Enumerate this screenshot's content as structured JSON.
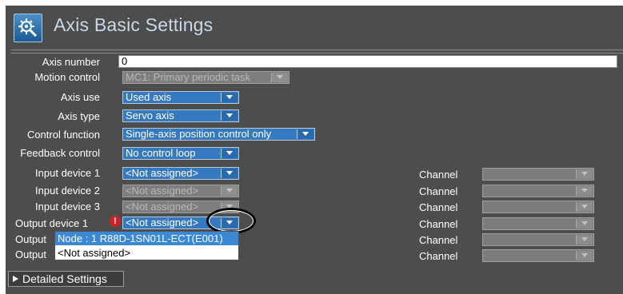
{
  "header": {
    "title": "Axis Basic Settings",
    "icon": "gear-magnifier-icon"
  },
  "fields": {
    "axis_number": {
      "label": "Axis number",
      "value": "0"
    },
    "motion_control": {
      "label": "Motion control",
      "value": "MC1: Primary periodic task"
    },
    "axis_use": {
      "label": "Axis use",
      "value": "Used axis"
    },
    "axis_type": {
      "label": "Axis type",
      "value": "Servo axis"
    },
    "control_function": {
      "label": "Control function",
      "value": "Single-axis position control only"
    },
    "feedback_control": {
      "label": "Feedback control",
      "value": "No control loop"
    },
    "input_device_1": {
      "label": "Input device 1",
      "value": "<Not assigned>"
    },
    "input_device_2": {
      "label": "Input device 2",
      "value": "<Not assigned>"
    },
    "input_device_3": {
      "label": "Input device 3",
      "value": "<Not assigned>"
    },
    "output_device_1": {
      "label": "Output device 1",
      "value": "<Not assigned>"
    },
    "output_device_2": {
      "label": "Output"
    },
    "output_device_3": {
      "label": "Output"
    }
  },
  "channel_label": "Channel",
  "dropdown_options": [
    "Node : 1 R88D-1SN01L-ECT(E001)",
    "<Not assigned>"
  ],
  "warning_symbol": "!",
  "detailed_settings": "Detailed Settings",
  "colors": {
    "panel": "#4d4d4d",
    "accent": "#3579c0",
    "selection": "#3b88d4",
    "warning": "#d0202a"
  }
}
